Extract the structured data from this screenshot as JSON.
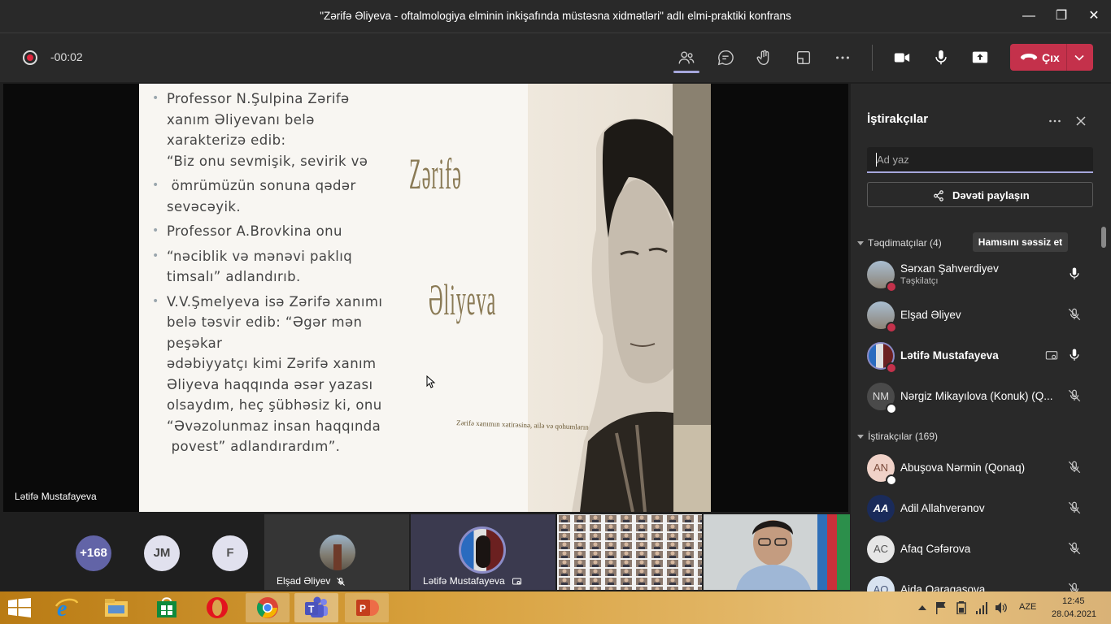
{
  "window": {
    "title": "\"Zərifə Əliyeva - oftalmologiya elminin inkişafında müstəsna xidmətləri\" adlı elmi-praktiki konfrans",
    "minimize": "—",
    "maximize": "❐",
    "close": "✕"
  },
  "toolbar": {
    "recording_time": "-00:02",
    "leave_label": "Çıx"
  },
  "slide": {
    "bullets": [
      [
        "Professor N.Şulpina Zərifə",
        "xanım Əliyevanı belə",
        "xarakterizə edib:",
        "“Biz onu sevmişik, sevirik və"
      ],
      [
        " ömrümüzün sonuna qədər",
        "sevəcəyik."
      ],
      [
        "Professor A.Brovkina onu"
      ],
      [
        "“nəciblik və mənəvi paklıq",
        "timsalı” adlandırıb."
      ],
      [
        "V.V.Şmelyeva isə Zərifə xanımı",
        "belə təsvir edib: “Əgər mən",
        "peşəkar",
        "ədəbiyyatçı kimi Zərifə xanım",
        "Əliyeva haqqında əsər yazası",
        "olsaydım, heç şübhəsiz ki, onu",
        "“Əvəzolunmaz insan haqqında",
        " povest” adlandırardım”."
      ]
    ],
    "title_word1": "Zərifə",
    "title_word2": "Əliyeva",
    "caption": "Zərifə xanımın xatirəsinə, ailə və qohumlarına"
  },
  "stage": {
    "presenter_name": "Lətifə Mustafayeva"
  },
  "filmstrip": {
    "more_count": "+168",
    "initials_1": "JM",
    "initials_2": "F",
    "tile_1_name": "Elşad Əliyev",
    "tile_2_name": "Lətifə Mustafayeva"
  },
  "panel": {
    "title": "İştirakçılar",
    "search_placeholder": "Ad yaz",
    "share_label": "Dəvəti paylaşın",
    "presenters_header": "Təqdimatçılar (4)",
    "mute_all_label": "Hamısını səssiz et",
    "attendees_header": "İştirakçılar (169)",
    "presenters": [
      {
        "name": "Sərxan Şahverdiyev",
        "role": "Təşkilatçı",
        "initials": "",
        "muted": false
      },
      {
        "name": "Elşad Əliyev",
        "role": "",
        "initials": "",
        "muted": true
      },
      {
        "name": "Lətifə Mustafayeva",
        "role": "",
        "initials": "",
        "muted": false
      },
      {
        "name": "Nərgiz Mikayılova (Konuk) (Q...",
        "role": "",
        "initials": "NM",
        "muted": true
      }
    ],
    "attendees": [
      {
        "name": "Abuşova Nərmin (Qonaq)",
        "initials": "AN",
        "muted": true
      },
      {
        "name": "Adil Allahverənov",
        "initials": "AA",
        "muted": true
      },
      {
        "name": "Afaq Cəfərova",
        "initials": "AC",
        "muted": true
      },
      {
        "name": "Aida Qaragaşova",
        "initials": "AQ",
        "muted": true
      }
    ]
  },
  "taskbar": {
    "language": "AZE",
    "time": "12:45",
    "date": "28.04.2021"
  }
}
